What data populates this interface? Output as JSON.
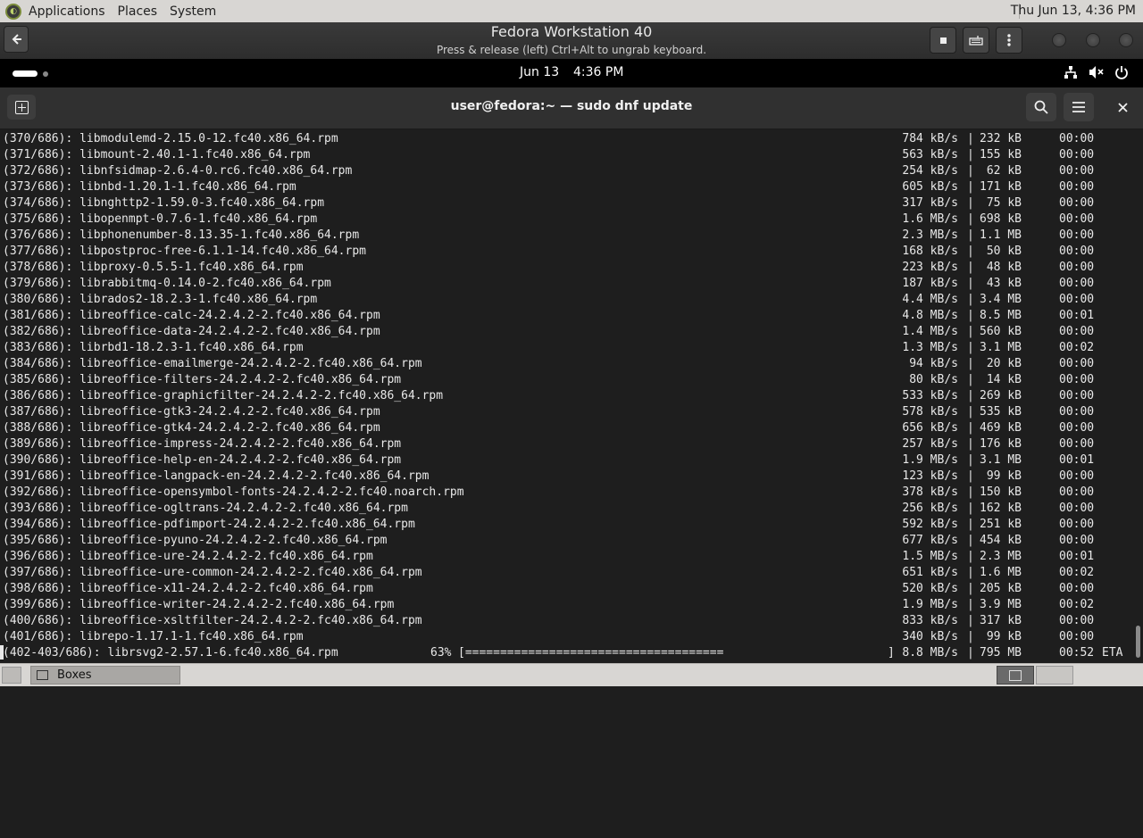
{
  "host_panel": {
    "menus": [
      "Applications",
      "Places",
      "System"
    ],
    "clock": "Thu Jun 13,  4:36 PM"
  },
  "boxes_header": {
    "title": "Fedora Workstation 40",
    "subtitle": "Press & release (left) Ctrl+Alt to ungrab keyboard.",
    "back_icon": "back-arrow-icon",
    "buttons": [
      "stop-icon",
      "keyboard-icon",
      "more-icon"
    ],
    "window_controls": [
      "minimize",
      "maximize",
      "close"
    ]
  },
  "guest_topbar": {
    "date": "Jun 13",
    "time": "4:36 PM",
    "tray_icons": [
      "network-icon",
      "volume-muted-icon",
      "power-icon"
    ]
  },
  "terminal": {
    "title": "user@fedora:~ — sudo dnf update",
    "lines": [
      {
        "name": "(370/686): libmodulemd-2.15.0-12.fc40.x86_64.rpm",
        "speed": "784 kB/s",
        "size": "232 kB",
        "eta": "00:00"
      },
      {
        "name": "(371/686): libmount-2.40.1-1.fc40.x86_64.rpm",
        "speed": "563 kB/s",
        "size": "155 kB",
        "eta": "00:00"
      },
      {
        "name": "(372/686): libnfsidmap-2.6.4-0.rc6.fc40.x86_64.rpm",
        "speed": "254 kB/s",
        "size": "62 kB",
        "eta": "00:00"
      },
      {
        "name": "(373/686): libnbd-1.20.1-1.fc40.x86_64.rpm",
        "speed": "605 kB/s",
        "size": "171 kB",
        "eta": "00:00"
      },
      {
        "name": "(374/686): libnghttp2-1.59.0-3.fc40.x86_64.rpm",
        "speed": "317 kB/s",
        "size": "75 kB",
        "eta": "00:00"
      },
      {
        "name": "(375/686): libopenmpt-0.7.6-1.fc40.x86_64.rpm",
        "speed": "1.6 MB/s",
        "size": "698 kB",
        "eta": "00:00"
      },
      {
        "name": "(376/686): libphonenumber-8.13.35-1.fc40.x86_64.rpm",
        "speed": "2.3 MB/s",
        "size": "1.1 MB",
        "eta": "00:00"
      },
      {
        "name": "(377/686): libpostproc-free-6.1.1-14.fc40.x86_64.rpm",
        "speed": "168 kB/s",
        "size": "50 kB",
        "eta": "00:00"
      },
      {
        "name": "(378/686): libproxy-0.5.5-1.fc40.x86_64.rpm",
        "speed": "223 kB/s",
        "size": "48 kB",
        "eta": "00:00"
      },
      {
        "name": "(379/686): librabbitmq-0.14.0-2.fc40.x86_64.rpm",
        "speed": "187 kB/s",
        "size": "43 kB",
        "eta": "00:00"
      },
      {
        "name": "(380/686): librados2-18.2.3-1.fc40.x86_64.rpm",
        "speed": "4.4 MB/s",
        "size": "3.4 MB",
        "eta": "00:00"
      },
      {
        "name": "(381/686): libreoffice-calc-24.2.4.2-2.fc40.x86_64.rpm",
        "speed": "4.8 MB/s",
        "size": "8.5 MB",
        "eta": "00:01"
      },
      {
        "name": "(382/686): libreoffice-data-24.2.4.2-2.fc40.x86_64.rpm",
        "speed": "1.4 MB/s",
        "size": "560 kB",
        "eta": "00:00"
      },
      {
        "name": "(383/686): librbd1-18.2.3-1.fc40.x86_64.rpm",
        "speed": "1.3 MB/s",
        "size": "3.1 MB",
        "eta": "00:02"
      },
      {
        "name": "(384/686): libreoffice-emailmerge-24.2.4.2-2.fc40.x86_64.rpm",
        "speed": "94 kB/s",
        "size": "20 kB",
        "eta": "00:00"
      },
      {
        "name": "(385/686): libreoffice-filters-24.2.4.2-2.fc40.x86_64.rpm",
        "speed": "80 kB/s",
        "size": "14 kB",
        "eta": "00:00"
      },
      {
        "name": "(386/686): libreoffice-graphicfilter-24.2.4.2-2.fc40.x86_64.rpm",
        "speed": "533 kB/s",
        "size": "269 kB",
        "eta": "00:00"
      },
      {
        "name": "(387/686): libreoffice-gtk3-24.2.4.2-2.fc40.x86_64.rpm",
        "speed": "578 kB/s",
        "size": "535 kB",
        "eta": "00:00"
      },
      {
        "name": "(388/686): libreoffice-gtk4-24.2.4.2-2.fc40.x86_64.rpm",
        "speed": "656 kB/s",
        "size": "469 kB",
        "eta": "00:00"
      },
      {
        "name": "(389/686): libreoffice-impress-24.2.4.2-2.fc40.x86_64.rpm",
        "speed": "257 kB/s",
        "size": "176 kB",
        "eta": "00:00"
      },
      {
        "name": "(390/686): libreoffice-help-en-24.2.4.2-2.fc40.x86_64.rpm",
        "speed": "1.9 MB/s",
        "size": "3.1 MB",
        "eta": "00:01"
      },
      {
        "name": "(391/686): libreoffice-langpack-en-24.2.4.2-2.fc40.x86_64.rpm",
        "speed": "123 kB/s",
        "size": "99 kB",
        "eta": "00:00"
      },
      {
        "name": "(392/686): libreoffice-opensymbol-fonts-24.2.4.2-2.fc40.noarch.rpm",
        "speed": "378 kB/s",
        "size": "150 kB",
        "eta": "00:00"
      },
      {
        "name": "(393/686): libreoffice-ogltrans-24.2.4.2-2.fc40.x86_64.rpm",
        "speed": "256 kB/s",
        "size": "162 kB",
        "eta": "00:00"
      },
      {
        "name": "(394/686): libreoffice-pdfimport-24.2.4.2-2.fc40.x86_64.rpm",
        "speed": "592 kB/s",
        "size": "251 kB",
        "eta": "00:00"
      },
      {
        "name": "(395/686): libreoffice-pyuno-24.2.4.2-2.fc40.x86_64.rpm",
        "speed": "677 kB/s",
        "size": "454 kB",
        "eta": "00:00"
      },
      {
        "name": "(396/686): libreoffice-ure-24.2.4.2-2.fc40.x86_64.rpm",
        "speed": "1.5 MB/s",
        "size": "2.3 MB",
        "eta": "00:01"
      },
      {
        "name": "(397/686): libreoffice-ure-common-24.2.4.2-2.fc40.x86_64.rpm",
        "speed": "651 kB/s",
        "size": "1.6 MB",
        "eta": "00:02"
      },
      {
        "name": "(398/686): libreoffice-x11-24.2.4.2-2.fc40.x86_64.rpm",
        "speed": "520 kB/s",
        "size": "205 kB",
        "eta": "00:00"
      },
      {
        "name": "(399/686): libreoffice-writer-24.2.4.2-2.fc40.x86_64.rpm",
        "speed": "1.9 MB/s",
        "size": "3.9 MB",
        "eta": "00:02"
      },
      {
        "name": "(400/686): libreoffice-xsltfilter-24.2.4.2-2.fc40.x86_64.rpm",
        "speed": "833 kB/s",
        "size": "317 kB",
        "eta": "00:00"
      },
      {
        "name": "(401/686): librepo-1.17.1-1.fc40.x86_64.rpm",
        "speed": "340 kB/s",
        "size": "99 kB",
        "eta": "00:00"
      }
    ],
    "progress_line": {
      "name": "(402-403/686): librsvg2-2.57.1-6.fc40.x86_64.rpm",
      "percent": "63%",
      "bar": "[=====================================",
      "bar_end": "]",
      "speed": "8.8 MB/s",
      "size": "795 MB",
      "eta": "00:52",
      "eta_label": "ETA"
    }
  },
  "host_taskbar": {
    "task_label": "Boxes"
  }
}
